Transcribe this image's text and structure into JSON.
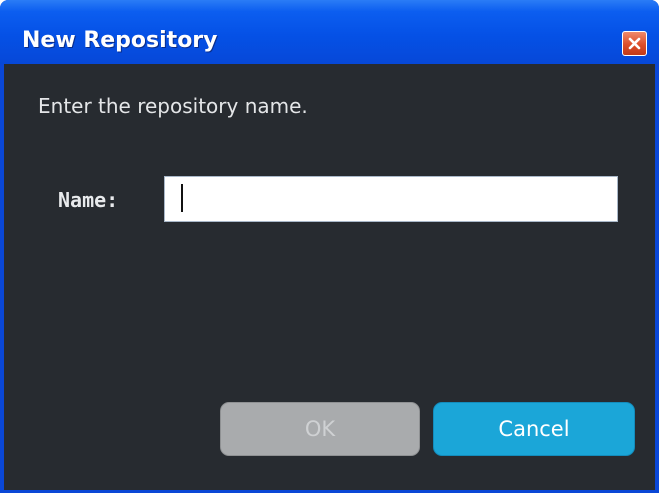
{
  "window": {
    "title": "New Repository",
    "close_icon": "close-icon"
  },
  "dialog": {
    "prompt": "Enter the repository name.",
    "name_label": "Name:",
    "name_value": ""
  },
  "buttons": {
    "ok_label": "OK",
    "ok_enabled": false,
    "cancel_label": "Cancel"
  },
  "colors": {
    "titlebar": "#0551e6",
    "client_background": "#272b30",
    "ok_disabled": "#a9abad",
    "cancel_accent": "#1ba6d8",
    "close_button": "#dd4e2a"
  }
}
